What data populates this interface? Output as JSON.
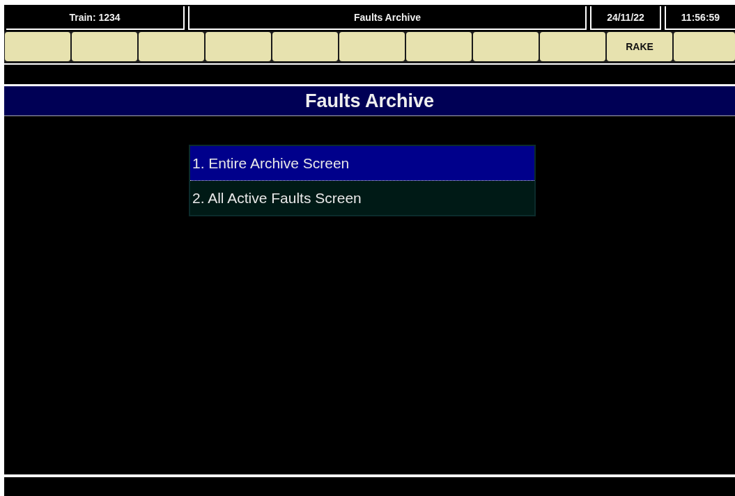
{
  "header": {
    "train": "Train: 1234",
    "title": "Faults Archive",
    "date": "24/11/22",
    "time": "11:56:59"
  },
  "soft_keys": [
    {
      "kind": "blank"
    },
    {
      "kind": "blank"
    },
    {
      "kind": "blank"
    },
    {
      "kind": "blank"
    },
    {
      "kind": "blank"
    },
    {
      "kind": "blank"
    },
    {
      "kind": "blank"
    },
    {
      "kind": "blank"
    },
    {
      "kind": "blank"
    },
    {
      "kind": "label",
      "label": "RAKE"
    },
    {
      "kind": "blank"
    }
  ],
  "page_title": "Faults Archive",
  "menu": [
    {
      "label": "1. Entire Archive Screen",
      "selected": true
    },
    {
      "label": "2. All Active Faults Screen",
      "selected": false
    }
  ]
}
